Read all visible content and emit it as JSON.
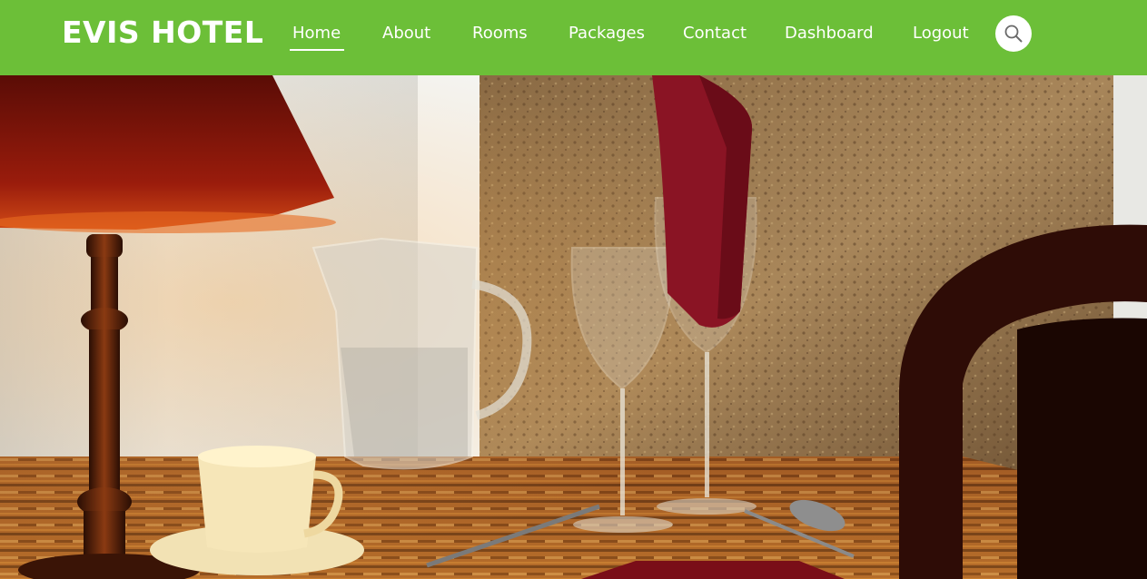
{
  "brand": {
    "name": "EVIS HOTEL"
  },
  "nav": {
    "items": [
      {
        "label": "Home",
        "active": true
      },
      {
        "label": "About",
        "active": false
      },
      {
        "label": "Rooms",
        "active": false
      },
      {
        "label": "Packages",
        "active": false
      },
      {
        "label": "Contact",
        "active": false
      },
      {
        "label": "Dashboard",
        "active": false
      },
      {
        "label": "Logout",
        "active": false
      }
    ],
    "search_icon": "search-icon"
  },
  "hero": {
    "image": "dining-table-with-lamp-pitcher-wineglasses-photo"
  },
  "colors": {
    "navbar": "#6cbf38",
    "text": "#ffffff"
  }
}
